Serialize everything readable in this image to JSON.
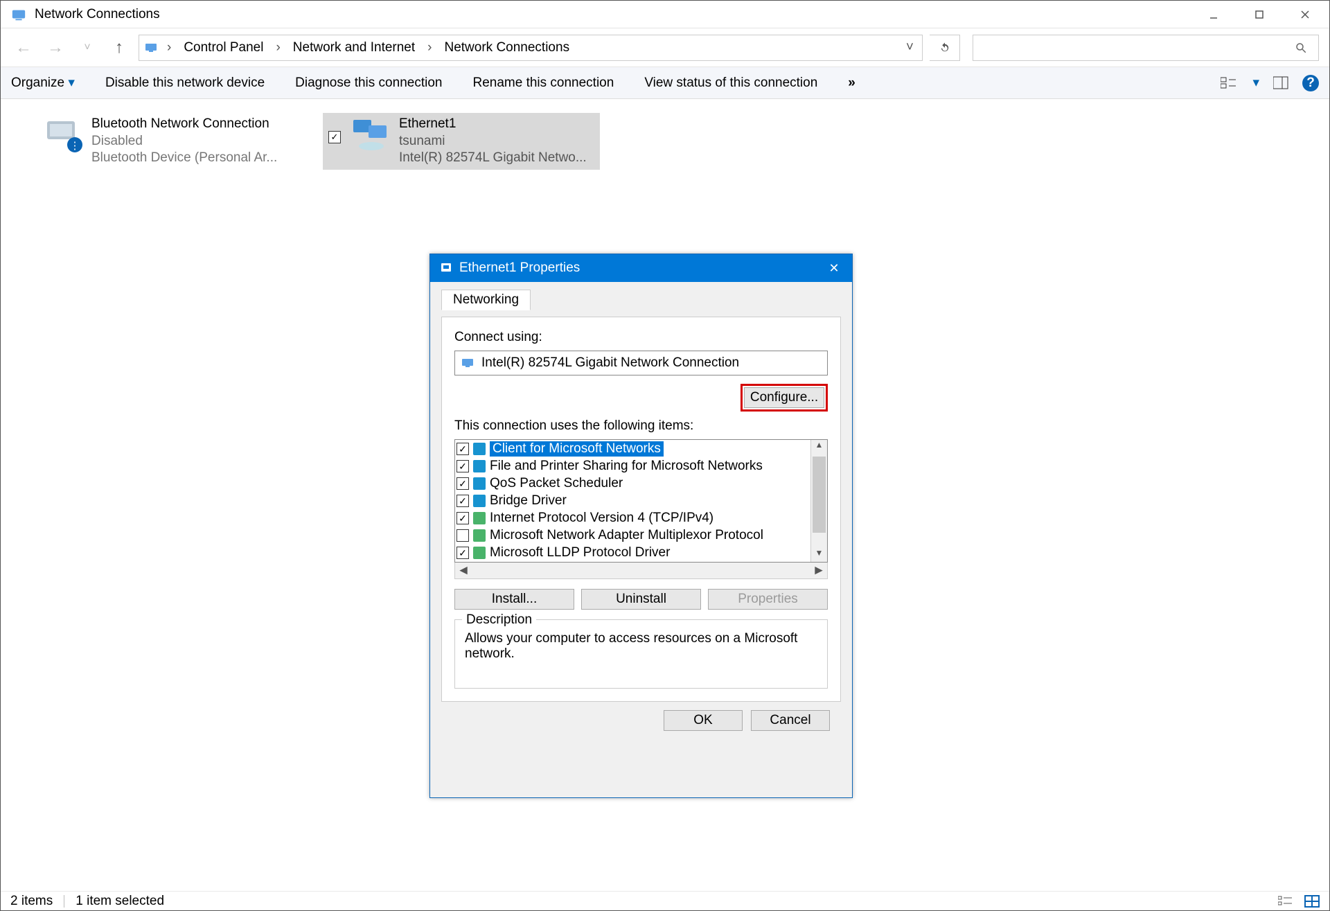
{
  "window": {
    "title": "Network Connections"
  },
  "breadcrumbs": [
    "Control Panel",
    "Network and Internet",
    "Network Connections"
  ],
  "toolbar": {
    "organize": "Organize",
    "disable": "Disable this network device",
    "diagnose": "Diagnose this connection",
    "rename": "Rename this connection",
    "view_status": "View status of this connection",
    "overflow": "»"
  },
  "connections": [
    {
      "name": "Bluetooth Network Connection",
      "line2": "Disabled",
      "line3": "Bluetooth Device (Personal Ar...",
      "selected": false,
      "checked": false
    },
    {
      "name": "Ethernet1",
      "line2": "tsunami",
      "line3": "Intel(R) 82574L Gigabit Netwo...",
      "selected": true,
      "checked": true
    }
  ],
  "statusbar": {
    "count": "2 items",
    "selected": "1 item selected"
  },
  "dialog": {
    "title": "Ethernet1 Properties",
    "tab": "Networking",
    "connect_using_label": "Connect using:",
    "adapter": "Intel(R) 82574L Gigabit Network Connection",
    "configure": "Configure...",
    "items_label": "This connection uses the following items:",
    "items": [
      {
        "checked": true,
        "selected": true,
        "icon": "blue",
        "label": "Client for Microsoft Networks"
      },
      {
        "checked": true,
        "selected": false,
        "icon": "blue",
        "label": "File and Printer Sharing for Microsoft Networks"
      },
      {
        "checked": true,
        "selected": false,
        "icon": "blue",
        "label": "QoS Packet Scheduler"
      },
      {
        "checked": true,
        "selected": false,
        "icon": "blue",
        "label": "Bridge Driver"
      },
      {
        "checked": true,
        "selected": false,
        "icon": "green",
        "label": "Internet Protocol Version 4 (TCP/IPv4)"
      },
      {
        "checked": false,
        "selected": false,
        "icon": "green",
        "label": "Microsoft Network Adapter Multiplexor Protocol"
      },
      {
        "checked": true,
        "selected": false,
        "icon": "green",
        "label": "Microsoft LLDP Protocol Driver"
      }
    ],
    "install": "Install...",
    "uninstall": "Uninstall",
    "properties": "Properties",
    "description_label": "Description",
    "description_text": "Allows your computer to access resources on a Microsoft network.",
    "ok": "OK",
    "cancel": "Cancel"
  }
}
